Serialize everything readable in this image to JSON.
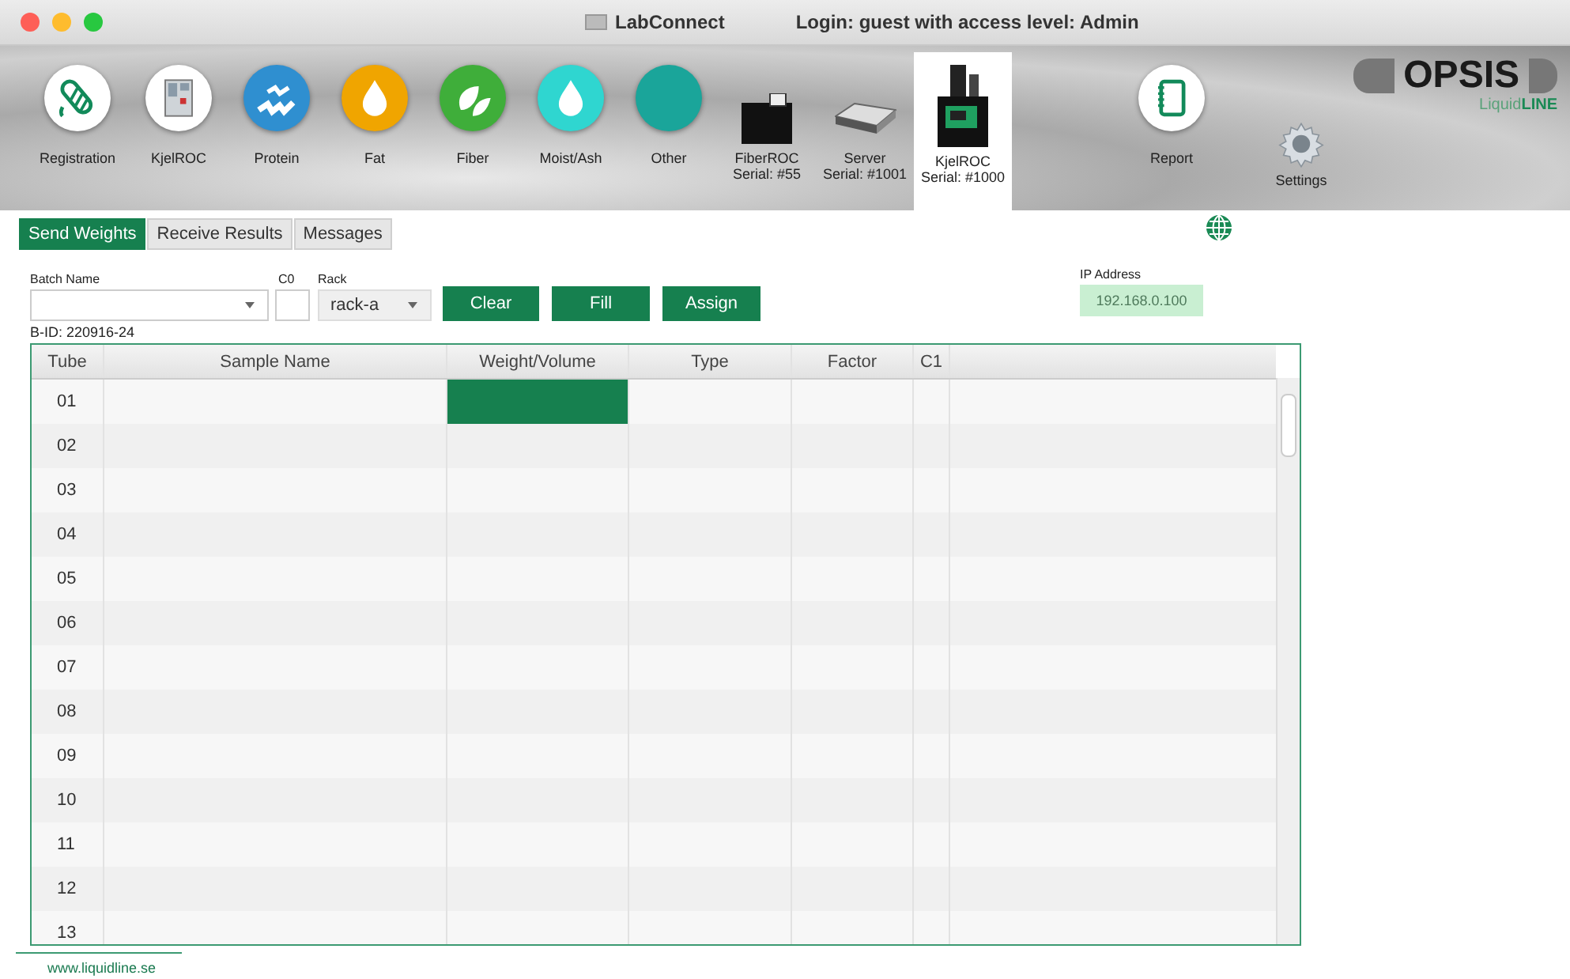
{
  "window": {
    "title": "LabConnect",
    "login": "Login: guest with access level: Admin"
  },
  "toolbar": [
    {
      "label": "Registration",
      "kind": "circle",
      "color": "#ffffff",
      "selected": false
    },
    {
      "label": "KjelROC",
      "kind": "circle",
      "color": "#ffffff",
      "selected": false
    },
    {
      "label": "Protein",
      "kind": "circle",
      "color": "#2f8fd0",
      "selected": false
    },
    {
      "label": "Fat",
      "kind": "circle",
      "color": "#f0a500",
      "selected": false
    },
    {
      "label": "Fiber",
      "kind": "circle",
      "color": "#3fae3a",
      "selected": false
    },
    {
      "label": "Moist/Ash",
      "kind": "circle",
      "color": "#2fd6d0",
      "selected": false
    },
    {
      "label": "Other",
      "kind": "circle",
      "color": "#1aa59a",
      "selected": false
    },
    {
      "label": "FiberROC",
      "serial": "Serial: #55",
      "kind": "device",
      "selected": false
    },
    {
      "label": "Server",
      "serial": "Serial: #1001",
      "kind": "device",
      "selected": false
    },
    {
      "label": "KjelROC",
      "serial": "Serial: #1000",
      "kind": "device",
      "selected": true
    },
    {
      "label": "Report",
      "kind": "circle",
      "color": "#ffffff",
      "selected": false
    },
    {
      "label": "Settings",
      "kind": "gear",
      "selected": false
    }
  ],
  "logo": {
    "name": "OPSIS",
    "sub1": "Liquid",
    "sub2": "LINE"
  },
  "tabs": [
    {
      "label": "Send Weights",
      "selected": true
    },
    {
      "label": "Receive Results",
      "selected": false
    },
    {
      "label": "Messages",
      "selected": false
    }
  ],
  "form": {
    "batch_label": "Batch Name",
    "c0_label": "C0",
    "rack_label": "Rack",
    "rack_value": "rack-a",
    "buttons": [
      "Clear",
      "Fill",
      "Assign"
    ],
    "bid": "B-ID: 220916-24",
    "ip_label": "IP Address",
    "ip_value": "192.168.0.100"
  },
  "table": {
    "columns": [
      "Tube",
      "Sample Name",
      "Weight/Volume",
      "Type",
      "Factor",
      "C1"
    ],
    "rows": [
      {
        "tube": "01",
        "weight_selected": true
      },
      {
        "tube": "02",
        "weight_selected": false
      },
      {
        "tube": "03",
        "weight_selected": false
      },
      {
        "tube": "04",
        "weight_selected": false
      },
      {
        "tube": "05",
        "weight_selected": false
      },
      {
        "tube": "06",
        "weight_selected": false
      },
      {
        "tube": "07",
        "weight_selected": false
      },
      {
        "tube": "08",
        "weight_selected": false
      },
      {
        "tube": "09",
        "weight_selected": false
      },
      {
        "tube": "10",
        "weight_selected": false
      },
      {
        "tube": "11",
        "weight_selected": false
      },
      {
        "tube": "12",
        "weight_selected": false
      },
      {
        "tube": "13",
        "weight_selected": false
      }
    ]
  },
  "footer": {
    "link": "www.liquidline.se"
  }
}
